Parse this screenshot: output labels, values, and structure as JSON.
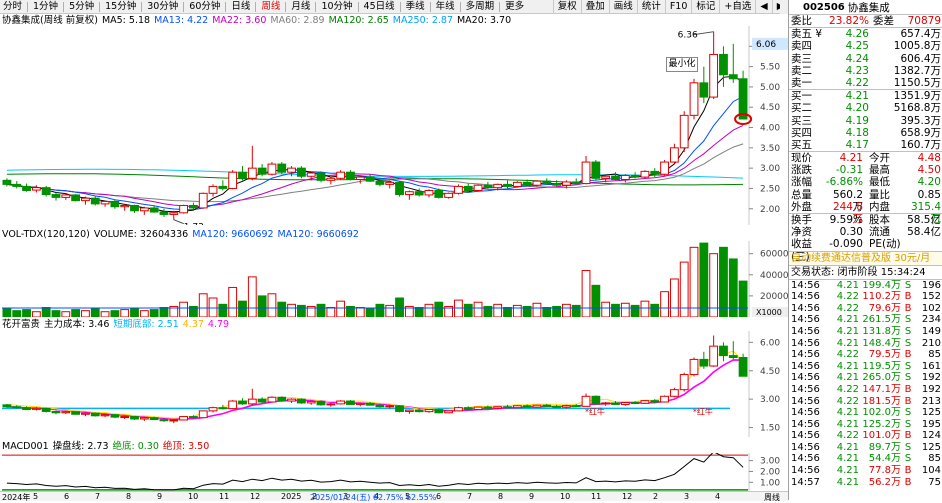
{
  "toolbar": {
    "items": [
      "分时",
      "1分钟",
      "5分钟",
      "15分钟",
      "30分钟",
      "60分钟",
      "日线",
      "周线",
      "月线",
      "10分钟",
      "45日线",
      "季线",
      "年线",
      "多周期",
      "更多"
    ],
    "active_index": 7,
    "right_items": [
      "复权",
      "叠加",
      "画线",
      "统计",
      "F10",
      "标记",
      "+自选",
      "◀",
      "▶"
    ]
  },
  "kline": {
    "title": "协鑫集成(周线 前复权)",
    "ma": [
      {
        "label": "MA5: 5.18",
        "color": "#000000"
      },
      {
        "label": "MA13: 4.22",
        "color": "#0050ff"
      },
      {
        "label": "MA22: 3.60",
        "color": "#c000c0"
      },
      {
        "label": "MA60: 2.89",
        "color": "#808080"
      },
      {
        "label": "MA120: 2.65",
        "color": "#008000"
      },
      {
        "label": "MA250: 2.87",
        "color": "#00a0ff"
      },
      {
        "label": "MA20: 3.70",
        "color": "#000000"
      }
    ],
    "price_axis": [
      "6.00",
      "5.50",
      "5.00",
      "4.50",
      "4.00",
      "3.50",
      "3.00",
      "2.50",
      "2.00"
    ],
    "highlight_price": "6.06",
    "high_label": "6.36",
    "low_label": "1.73",
    "minimize_label": "最小化"
  },
  "volume": {
    "legend": [
      "VOL-TDX(120,120)",
      "VOLUME: 32604336",
      "MA120: 9660692",
      "MA120: 9660692"
    ],
    "axis": [
      "60000",
      "40000",
      "20000"
    ],
    "unit": "X1000"
  },
  "cost": {
    "legend": [
      "花开富贵",
      "主力成本: 3.46",
      "短期底部: 2.51",
      "4.37",
      "4.79"
    ],
    "axis": [
      "6.00",
      "4.50",
      "3.00",
      "1.50"
    ],
    "tags": [
      "*红牛",
      "*红牛"
    ],
    "colors": {
      "magenta": "#ff00ff",
      "cyan": "#00b0ff",
      "yellow": "#ffe000",
      "orange": "#ff9000"
    }
  },
  "macd": {
    "legend": [
      "MACD001",
      "操盘线: 2.73",
      "绝底: 0.30",
      "绝顶: 3.50"
    ],
    "axis": [
      "3.00",
      "2.00",
      "1.00"
    ]
  },
  "xaxis": {
    "labels": [
      "2024年",
      "5",
      "6",
      "7",
      "8",
      "9",
      "10",
      "11",
      "12",
      "2025",
      "2",
      "3",
      "4",
      "5",
      "6",
      "7",
      "8",
      "9",
      "10",
      "11",
      "12",
      "2",
      "3",
      "4"
    ],
    "note": "2025/01/24(五) 62.75% 62.55%",
    "right_label": "周线"
  },
  "quote": {
    "code": "002506",
    "name": "协鑫集成",
    "weibi_label": "委比",
    "weibi": "23.82%",
    "weicha_label": "委差",
    "weicha": "70879",
    "asks": [
      {
        "label": "卖五 ¥",
        "price": "4.26",
        "vol": "657.4万"
      },
      {
        "label": "卖四",
        "price": "4.25",
        "vol": "1005.8万"
      },
      {
        "label": "卖三",
        "price": "4.24",
        "vol": "606.4万"
      },
      {
        "label": "卖二",
        "price": "4.23",
        "vol": "1382.7万"
      },
      {
        "label": "卖一",
        "price": "4.22",
        "vol": "1150.5万"
      }
    ],
    "bids": [
      {
        "label": "买一",
        "price": "4.21",
        "vol": "1351.9万"
      },
      {
        "label": "买二",
        "price": "4.20",
        "vol": "5168.8万"
      },
      {
        "label": "买三",
        "price": "4.19",
        "vol": "395.3万"
      },
      {
        "label": "买四",
        "price": "4.18",
        "vol": "658.9万"
      },
      {
        "label": "买五",
        "price": "4.17",
        "vol": "160.7万"
      }
    ],
    "stats": [
      {
        "k1": "现价",
        "v1": "4.21",
        "c1": "red",
        "k2": "今开",
        "v2": "4.48",
        "c2": "red"
      },
      {
        "k1": "涨跌",
        "v1": "-0.31",
        "c1": "green",
        "k2": "最高",
        "v2": "4.50",
        "c2": "red"
      },
      {
        "k1": "涨幅",
        "v1": "-6.86%",
        "c1": "green",
        "k2": "最低",
        "v2": "4.20",
        "c2": "green"
      },
      {
        "k1": "总量",
        "v1": "560.2万",
        "c1": "blk",
        "k2": "量比",
        "v2": "0.85",
        "c2": "blk"
      },
      {
        "k1": "外盘",
        "v1": "244.8万",
        "c1": "red",
        "k2": "内盘",
        "v2": "315.4万",
        "c2": "green"
      }
    ],
    "stats2": [
      {
        "k1": "换手",
        "v1": "9.59%",
        "k2": "股本",
        "v2": "58.5亿"
      },
      {
        "k1": "净资",
        "v1": "0.30",
        "k2": "流通",
        "v2": "58.4亿"
      },
      {
        "k1": "收益(三)",
        "v1": "-0.090",
        "k2": "PE(动)",
        "v2": ""
      }
    ],
    "promo": "自动续费通达信普及版 30元/月",
    "status": "交易状态: 闭市阶段 15:34:24",
    "ticks": [
      {
        "t": "14:56",
        "p": "4.21",
        "v": "199.4万",
        "s": "S",
        "n": "196"
      },
      {
        "t": "14:56",
        "p": "4.22",
        "v": "110.2万",
        "s": "B",
        "n": "152"
      },
      {
        "t": "14:56",
        "p": "4.22",
        "v": "79.6万",
        "s": "B",
        "n": "102"
      },
      {
        "t": "14:56",
        "p": "4.21",
        "v": "261.5万",
        "s": "S",
        "n": "234"
      },
      {
        "t": "14:56",
        "p": "4.21",
        "v": "131.8万",
        "s": "S",
        "n": "149"
      },
      {
        "t": "14:56",
        "p": "4.21",
        "v": "148.4万",
        "s": "S",
        "n": "210"
      },
      {
        "t": "14:56",
        "p": "4.22",
        "v": "79.5万",
        "s": "B",
        "n": "85"
      },
      {
        "t": "14:56",
        "p": "4.21",
        "v": "119.5万",
        "s": "S",
        "n": "161"
      },
      {
        "t": "14:56",
        "p": "4.21",
        "v": "265.0万",
        "s": "S",
        "n": "192"
      },
      {
        "t": "14:56",
        "p": "4.22",
        "v": "147.1万",
        "s": "B",
        "n": "192"
      },
      {
        "t": "14:56",
        "p": "4.22",
        "v": "181.5万",
        "s": "B",
        "n": "213"
      },
      {
        "t": "14:56",
        "p": "4.21",
        "v": "102.0万",
        "s": "S",
        "n": "125"
      },
      {
        "t": "14:56",
        "p": "4.21",
        "v": "125.2万",
        "s": "S",
        "n": "195"
      },
      {
        "t": "14:56",
        "p": "4.22",
        "v": "101.0万",
        "s": "B",
        "n": "124"
      },
      {
        "t": "14:56",
        "p": "4.21",
        "v": "89.7万",
        "s": "S",
        "n": "125"
      },
      {
        "t": "14:56",
        "p": "4.21",
        "v": "54.4万",
        "s": "S",
        "n": "85"
      },
      {
        "t": "14:56",
        "p": "4.21",
        "v": "77.8万",
        "s": "B",
        "n": "104"
      },
      {
        "t": "14:57",
        "p": "4.21",
        "v": "56.2万",
        "s": "B",
        "n": "75"
      }
    ]
  },
  "series": {
    "candles": [
      [
        2.7,
        2.75,
        2.55,
        2.6
      ],
      [
        2.6,
        2.68,
        2.5,
        2.55
      ],
      [
        2.55,
        2.62,
        2.42,
        2.45
      ],
      [
        2.46,
        2.58,
        2.4,
        2.52
      ],
      [
        2.52,
        2.56,
        2.3,
        2.35
      ],
      [
        2.35,
        2.4,
        2.2,
        2.28
      ],
      [
        2.28,
        2.38,
        2.22,
        2.34
      ],
      [
        2.34,
        2.36,
        2.18,
        2.2
      ],
      [
        2.2,
        2.3,
        2.1,
        2.26
      ],
      [
        2.26,
        2.3,
        2.08,
        2.12
      ],
      [
        2.12,
        2.2,
        2.05,
        2.18
      ],
      [
        2.18,
        2.22,
        2.0,
        2.05
      ],
      [
        2.05,
        2.12,
        1.95,
        2.08
      ],
      [
        2.08,
        2.1,
        1.9,
        1.95
      ],
      [
        1.95,
        2.05,
        1.85,
        2.02
      ],
      [
        2.02,
        2.08,
        1.9,
        1.92
      ],
      [
        1.92,
        2.0,
        1.8,
        1.86
      ],
      [
        1.86,
        1.95,
        1.73,
        1.9
      ],
      [
        1.9,
        2.1,
        1.88,
        2.08
      ],
      [
        2.08,
        2.15,
        1.98,
        2.02
      ],
      [
        2.02,
        2.4,
        2.0,
        2.38
      ],
      [
        2.38,
        2.6,
        2.3,
        2.55
      ],
      [
        2.55,
        2.7,
        2.45,
        2.5
      ],
      [
        2.5,
        2.95,
        2.48,
        2.9
      ],
      [
        2.9,
        3.05,
        2.7,
        2.75
      ],
      [
        2.75,
        3.55,
        2.7,
        3.0
      ],
      [
        3.0,
        3.1,
        2.8,
        2.85
      ],
      [
        2.85,
        3.15,
        2.82,
        3.1
      ],
      [
        3.1,
        3.15,
        2.85,
        2.9
      ],
      [
        2.9,
        3.05,
        2.8,
        3.0
      ],
      [
        3.0,
        3.05,
        2.75,
        2.8
      ],
      [
        2.8,
        2.9,
        2.7,
        2.88
      ],
      [
        2.88,
        2.92,
        2.65,
        2.7
      ],
      [
        2.7,
        2.8,
        2.6,
        2.75
      ],
      [
        2.75,
        2.95,
        2.72,
        2.9
      ],
      [
        2.9,
        2.95,
        2.7,
        2.72
      ],
      [
        2.72,
        2.8,
        2.62,
        2.78
      ],
      [
        2.78,
        2.85,
        2.66,
        2.68
      ],
      [
        2.68,
        2.76,
        2.55,
        2.6
      ],
      [
        2.6,
        2.7,
        2.5,
        2.65
      ],
      [
        2.65,
        2.68,
        2.3,
        2.35
      ],
      [
        2.35,
        2.45,
        2.22,
        2.42
      ],
      [
        2.42,
        2.5,
        2.3,
        2.34
      ],
      [
        2.34,
        2.48,
        2.28,
        2.45
      ],
      [
        2.45,
        2.5,
        2.25,
        2.28
      ],
      [
        2.28,
        2.4,
        2.25,
        2.38
      ],
      [
        2.38,
        2.6,
        2.35,
        2.55
      ],
      [
        2.55,
        2.62,
        2.4,
        2.45
      ],
      [
        2.45,
        2.6,
        2.42,
        2.58
      ],
      [
        2.58,
        2.66,
        2.48,
        2.52
      ],
      [
        2.52,
        2.62,
        2.45,
        2.6
      ],
      [
        2.6,
        2.7,
        2.5,
        2.55
      ],
      [
        2.55,
        2.68,
        2.52,
        2.65
      ],
      [
        2.65,
        2.72,
        2.55,
        2.58
      ],
      [
        2.58,
        2.7,
        2.55,
        2.68
      ],
      [
        2.68,
        2.75,
        2.6,
        2.62
      ],
      [
        2.62,
        2.7,
        2.55,
        2.58
      ],
      [
        2.58,
        2.7,
        2.5,
        2.66
      ],
      [
        2.66,
        2.75,
        2.6,
        2.62
      ],
      [
        2.62,
        3.3,
        2.6,
        3.15
      ],
      [
        3.15,
        3.2,
        2.7,
        2.75
      ],
      [
        2.75,
        2.85,
        2.65,
        2.8
      ],
      [
        2.8,
        2.9,
        2.7,
        2.72
      ],
      [
        2.72,
        2.85,
        2.65,
        2.82
      ],
      [
        2.82,
        2.9,
        2.75,
        2.78
      ],
      [
        2.78,
        2.95,
        2.75,
        2.92
      ],
      [
        2.92,
        3.0,
        2.78,
        2.85
      ],
      [
        2.85,
        3.2,
        2.82,
        3.15
      ],
      [
        3.15,
        3.6,
        3.1,
        3.5
      ],
      [
        3.5,
        4.4,
        3.4,
        4.3
      ],
      [
        4.3,
        5.2,
        4.2,
        5.1
      ],
      [
        5.1,
        5.5,
        4.6,
        4.75
      ],
      [
        4.75,
        6.36,
        4.7,
        5.8
      ],
      [
        5.8,
        6.0,
        5.0,
        5.3
      ],
      [
        5.3,
        6.06,
        5.1,
        5.2
      ],
      [
        5.2,
        5.4,
        4.2,
        4.21
      ]
    ],
    "volumes": [
      8,
      6,
      7,
      5,
      9,
      6,
      5,
      7,
      6,
      8,
      5,
      6,
      7,
      8,
      6,
      7,
      9,
      10,
      14,
      10,
      22,
      18,
      12,
      28,
      15,
      38,
      20,
      22,
      14,
      12,
      11,
      10,
      12,
      9,
      15,
      10,
      9,
      8,
      12,
      11,
      18,
      10,
      9,
      12,
      14,
      10,
      16,
      12,
      14,
      10,
      12,
      9,
      11,
      10,
      13,
      9,
      10,
      12,
      11,
      44,
      30,
      14,
      12,
      13,
      11,
      15,
      12,
      24,
      36,
      52,
      66,
      70,
      60,
      66,
      55,
      34
    ]
  }
}
